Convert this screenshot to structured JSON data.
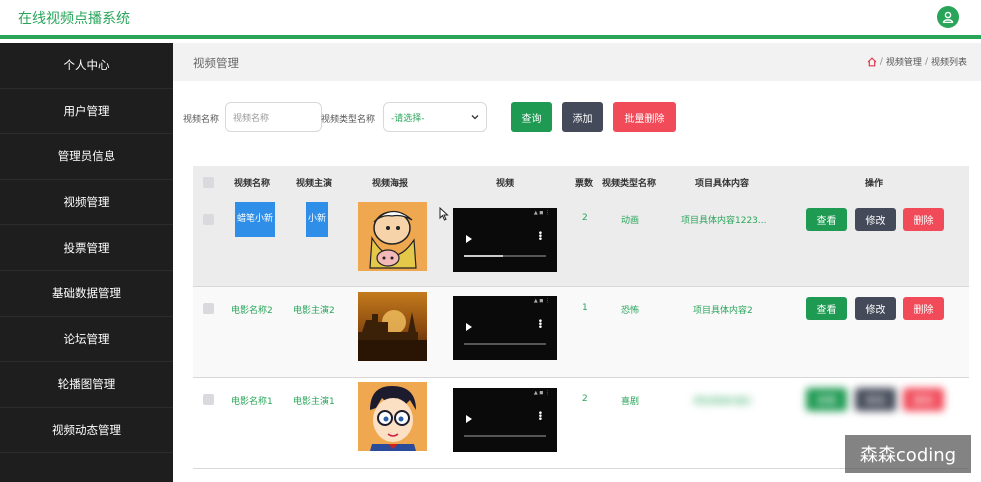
{
  "app": {
    "title": "在线视频点播系统"
  },
  "sidebar": {
    "items": [
      {
        "label": "个人中心"
      },
      {
        "label": "用户管理"
      },
      {
        "label": "管理员信息"
      },
      {
        "label": "视频管理"
      },
      {
        "label": "投票管理"
      },
      {
        "label": "基础数据管理"
      },
      {
        "label": "论坛管理"
      },
      {
        "label": "轮播图管理"
      },
      {
        "label": "视频动态管理"
      }
    ]
  },
  "page": {
    "title": "视频管理",
    "breadcrumb": [
      "视频管理",
      "视频列表"
    ]
  },
  "filter": {
    "name_label": "视频名称",
    "name_placeholder": "视频名称",
    "type_label": "视频类型名称",
    "type_selected": "-请选择-",
    "query_label": "查询",
    "add_label": "添加",
    "batch_delete_label": "批量删除"
  },
  "table": {
    "headers": [
      "视频名称",
      "视频主演",
      "视频海报",
      "视频",
      "票数",
      "视频类型名称",
      "项目具体内容",
      "操作"
    ],
    "rows": [
      {
        "name": "蜡笔小新",
        "actor": "小新",
        "votes": "2",
        "type": "动画",
        "content": "项目具体内容1223..."
      },
      {
        "name": "电影名称2",
        "actor": "电影主演2",
        "votes": "1",
        "type": "恐怖",
        "content": "项目具体内容2"
      },
      {
        "name": "电影名称1",
        "actor": "电影主演1",
        "votes": "2",
        "type": "喜剧",
        "content": "项目具体内容1"
      }
    ],
    "actions": {
      "view": "查看",
      "edit": "修改",
      "delete": "删除"
    }
  },
  "watermark": "森森coding",
  "colors": {
    "accent": "#29a55a",
    "sidebar": "#1e1e1e",
    "danger": "#f14b5a",
    "dark_button": "#444a59"
  }
}
